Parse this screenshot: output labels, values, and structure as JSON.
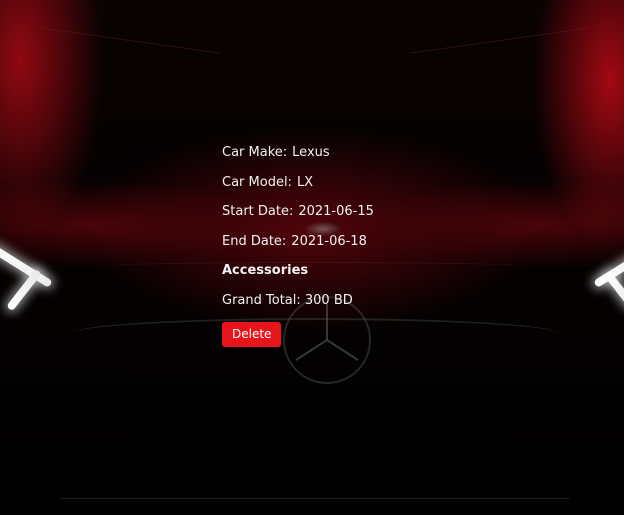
{
  "booking": {
    "make_label": "Car Make:",
    "make_value": "Lexus",
    "model_label": "Car Model:",
    "model_value": "LX",
    "start_label": "Start Date:",
    "start_value": "2021-06-15",
    "end_label": "End Date:",
    "end_value": "2021-06-18",
    "accessories_heading": "Accessories",
    "total_label": "Grand Total:",
    "total_value": "300 BD",
    "delete_label": "Delete"
  },
  "colors": {
    "accent": "#e8141c",
    "text": "#f2f2f2",
    "background": "#000000"
  }
}
